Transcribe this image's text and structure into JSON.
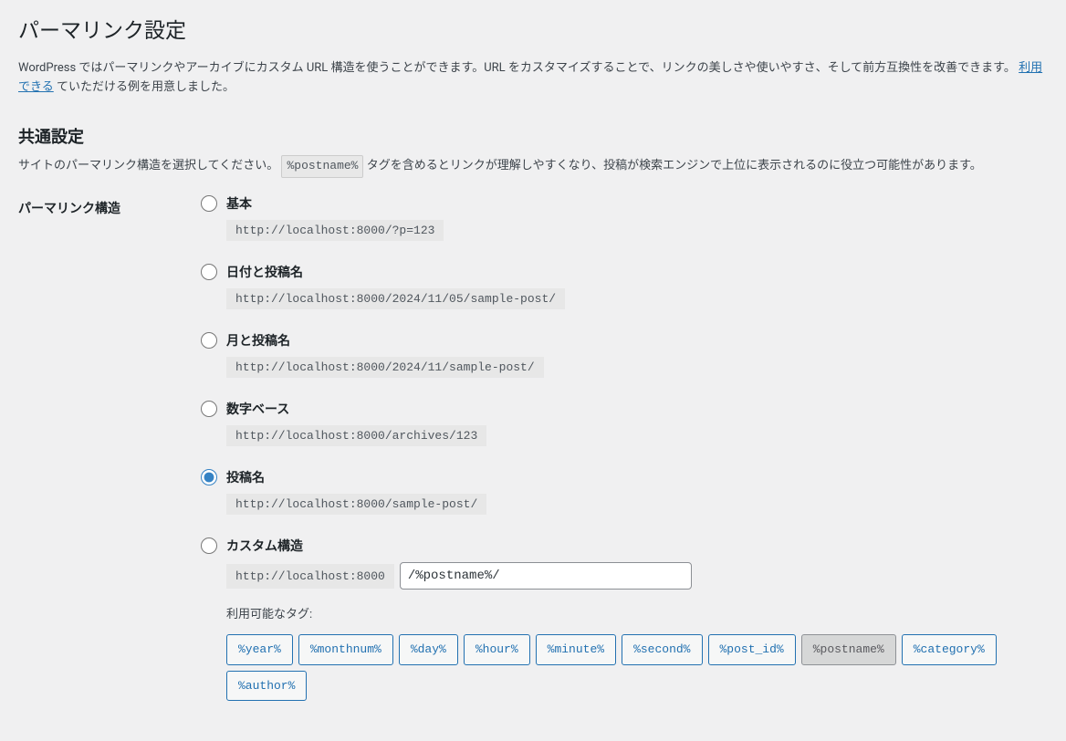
{
  "page": {
    "title": "パーマリンク設定",
    "intro_pre": "WordPress ではパーマリンクやアーカイブにカスタム URL 構造を使うことができます。URL をカスタマイズすることで、リンクの美しさや使いやすさ、そして前方互換性を改善できます。",
    "intro_link": "利用できる",
    "intro_post": "ていただける例を用意しました。"
  },
  "common": {
    "heading": "共通設定",
    "desc_pre": "サイトのパーマリンク構造を選択してください。",
    "desc_tag": "%postname%",
    "desc_post": "タグを含めるとリンクが理解しやすくなり、投稿が検索エンジンで上位に表示されるのに役立つ可能性があります。"
  },
  "structure": {
    "row_label": "パーマリンク構造",
    "options": {
      "plain": {
        "label": "基本",
        "example": "http://localhost:8000/?p=123"
      },
      "dayname": {
        "label": "日付と投稿名",
        "example": "http://localhost:8000/2024/11/05/sample-post/"
      },
      "monname": {
        "label": "月と投稿名",
        "example": "http://localhost:8000/2024/11/sample-post/"
      },
      "numeric": {
        "label": "数字ベース",
        "example": "http://localhost:8000/archives/123"
      },
      "postname": {
        "label": "投稿名",
        "example": "http://localhost:8000/sample-post/"
      },
      "custom": {
        "label": "カスタム構造",
        "prefix": "http://localhost:8000",
        "value": "/%postname%/"
      }
    },
    "selected": "postname",
    "available_tags_label": "利用可能なタグ:",
    "tags": [
      {
        "text": "%year%",
        "active": false
      },
      {
        "text": "%monthnum%",
        "active": false
      },
      {
        "text": "%day%",
        "active": false
      },
      {
        "text": "%hour%",
        "active": false
      },
      {
        "text": "%minute%",
        "active": false
      },
      {
        "text": "%second%",
        "active": false
      },
      {
        "text": "%post_id%",
        "active": false
      },
      {
        "text": "%postname%",
        "active": true
      },
      {
        "text": "%category%",
        "active": false
      },
      {
        "text": "%author%",
        "active": false
      }
    ]
  }
}
